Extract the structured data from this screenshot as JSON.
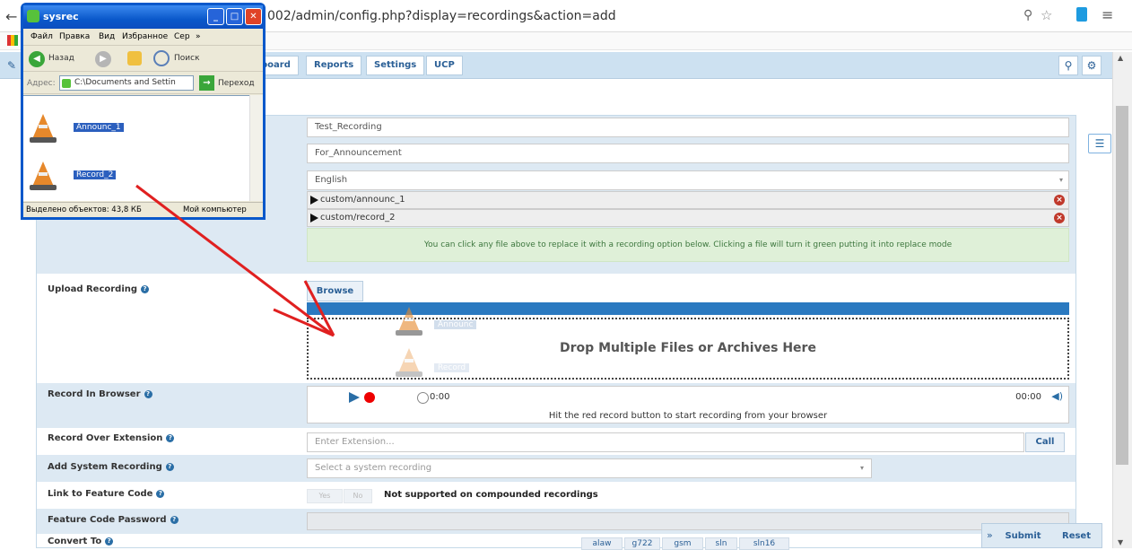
{
  "browser": {
    "url": "002/admin/config.php?display=recordings&action=add"
  },
  "nav": {
    "items": [
      "board",
      "Reports",
      "Settings",
      "UCP"
    ]
  },
  "form": {
    "name_value": "Test_Recording",
    "description_value": "For_Announcement",
    "language_value": "English",
    "files": [
      "custom/announc_1",
      "custom/record_2"
    ],
    "info_text": "You can click any file above to replace it with a recording option below. Clicking a file will turn it green putting it into replace mode",
    "upload_label": "Upload Recording",
    "browse_label": "Browse",
    "drop_text": "Drop Multiple Files or Archives Here",
    "ghost_files": [
      "Announc",
      "Record"
    ],
    "record_browser_label": "Record In Browser",
    "rec_time": "0:00",
    "rec_total": "00:00",
    "rec_hint": "Hit the red record button to start recording from your browser",
    "record_over_label": "Record Over Extension",
    "extension_placeholder": "Enter Extension...",
    "call_label": "Call",
    "system_recording_label": "Add System Recording",
    "system_recording_placeholder": "Select a system recording",
    "feature_code_label": "Link to Feature Code",
    "toggle_yes": "Yes",
    "toggle_no": "No",
    "not_supported": "Not supported on compounded recordings",
    "feature_password_label": "Feature Code Password",
    "convert_label": "Convert To",
    "codecs": [
      "alaw",
      "g722",
      "gsm",
      "sln",
      "sln16"
    ],
    "submit_label": "Submit",
    "reset_label": "Reset"
  },
  "explorer": {
    "title": "sysrec",
    "menu": [
      "Файл",
      "Правка",
      "Вид",
      "Избранное",
      "Сер"
    ],
    "back_label": "Назад",
    "search_label": "Поиск",
    "address_label": "Адрес:",
    "address_value": "C:\\Documents and Settin",
    "go_label": "Переход",
    "files": [
      "Announc_1",
      "Record_2"
    ],
    "status_left": "Выделено объектов: 43,8 КБ",
    "status_right": "Мой компьютер"
  },
  "colors": {
    "accent": "#2a79c0",
    "form_row_blue": "#dde9f3",
    "info_green": "#dff0d8",
    "xp_blue": "#0a58ca",
    "arrow_red": "#e02020"
  }
}
